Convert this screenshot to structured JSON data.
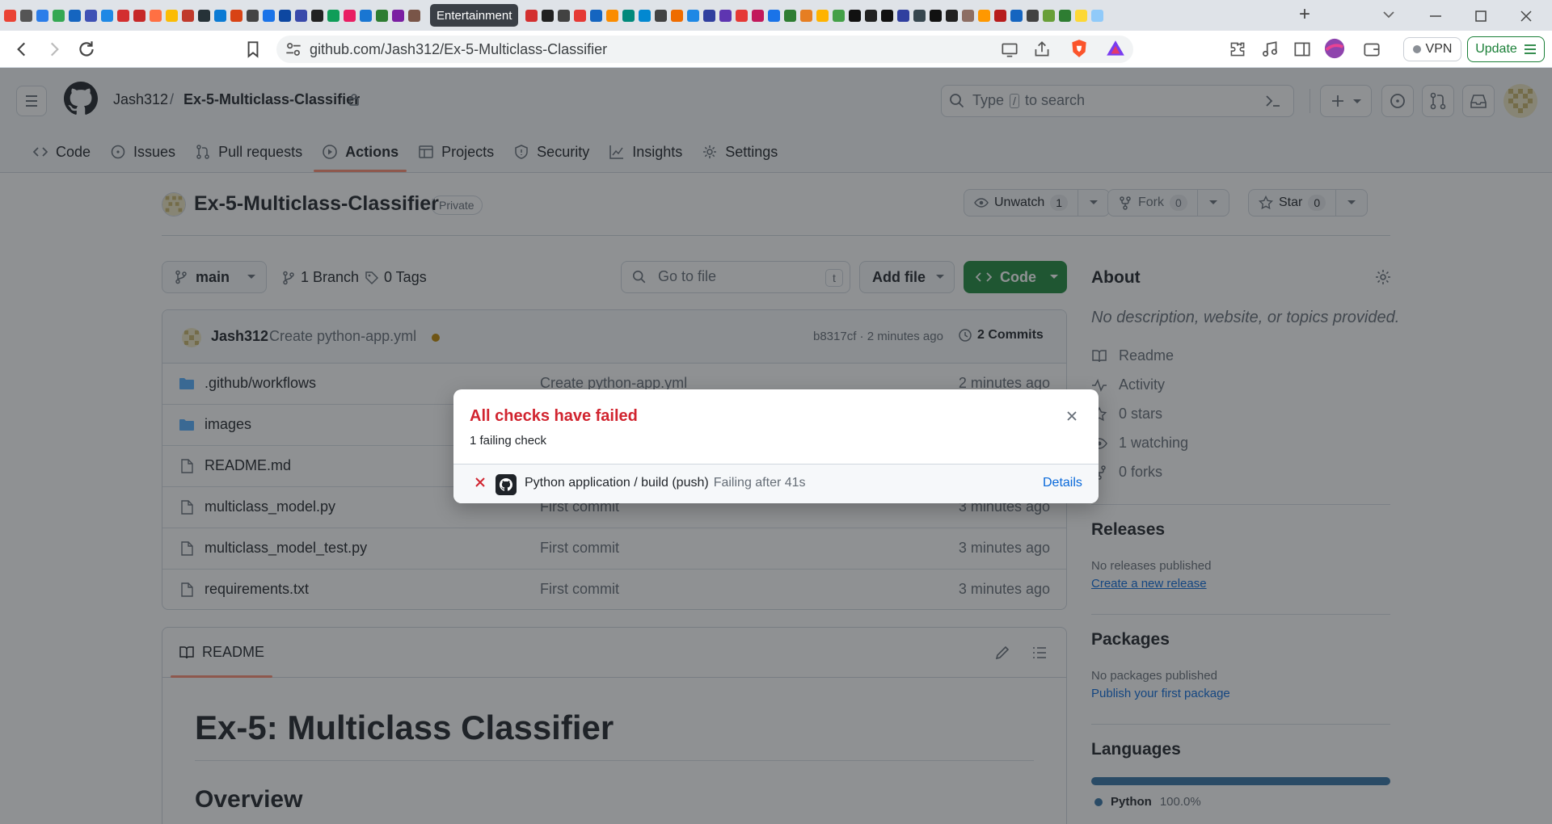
{
  "browser": {
    "active_tab_label": "Entertainment",
    "url": "github.com/Jash312/Ex-5-Multiclass-Classifier",
    "vpn_label": "VPN",
    "update_label": "Update",
    "favicon_colors": [
      "#ea4335",
      "#555",
      "#2b7de9",
      "#34a853",
      "#1565c0",
      "#3f51b5",
      "#1e88e5",
      "#d32f2f",
      "#c62828",
      "#ff7043",
      "#fbbc05",
      "#c0392b",
      "#263238",
      "#0b7bd4",
      "#d84315",
      "#444",
      "#1a73e8",
      "#0d47a1",
      "#3949ab",
      "#222",
      "#0f9d58",
      "#e91e63",
      "#1976d2",
      "#2e7d32",
      "#7b1fa2",
      "#795548"
    ],
    "favicon_colors_right": [
      "#d32f2f",
      "#212121",
      "#424242",
      "#e53935",
      "#1565c0",
      "#fb8c00",
      "#00897b",
      "#0288d1",
      "#424242",
      "#ef6c00",
      "#1e88e5",
      "#303f9f",
      "#5e35b1",
      "#e53935",
      "#c2185b",
      "#1a73e8",
      "#2e7d32",
      "#e67e22",
      "#ffb300",
      "#43a047",
      "#111",
      "#212121",
      "#111",
      "#303f9f",
      "#37474f",
      "#111",
      "#212121",
      "#8d6e63",
      "#ff9800",
      "#b71c1c",
      "#1565c0",
      "#424242",
      "#689f38",
      "#2e7d32",
      "#fdd835",
      "#90caf9"
    ]
  },
  "header": {
    "owner": "Jash312",
    "separator": "/",
    "repo": "Ex-5-Multiclass-Classifier",
    "search_prefix": "Type",
    "search_key": "/",
    "search_suffix": "to search"
  },
  "nav": [
    {
      "label": "Code",
      "icon": "code-icon"
    },
    {
      "label": "Issues",
      "icon": "issue-icon"
    },
    {
      "label": "Pull requests",
      "icon": "pull-request-icon"
    },
    {
      "label": "Actions",
      "icon": "play-icon",
      "active": true
    },
    {
      "label": "Projects",
      "icon": "table-icon"
    },
    {
      "label": "Security",
      "icon": "shield-icon"
    },
    {
      "label": "Insights",
      "icon": "graph-icon"
    },
    {
      "label": "Settings",
      "icon": "gear-icon"
    }
  ],
  "repo": {
    "title": "Ex-5-Multiclass-Classifier",
    "visibility": "Private",
    "unwatch_label": "Unwatch",
    "watch_count": "1",
    "fork_label": "Fork",
    "fork_count": "0",
    "star_label": "Star",
    "star_count": "0"
  },
  "browser_bar": {
    "branch": "main",
    "branches": "1 Branch",
    "tags": "0 Tags",
    "goto_placeholder": "Go to file",
    "goto_key": "t",
    "add_file": "Add file",
    "code": "Code"
  },
  "last_commit": {
    "author": "Jash312",
    "message": "Create python-app.yml",
    "hash_time": "b8317cf · 2 minutes ago",
    "commits": "2 Commits"
  },
  "files": [
    {
      "name": ".github/workflows",
      "type": "folder",
      "message": "Create python-app.yml",
      "time": "2 minutes ago"
    },
    {
      "name": "images",
      "type": "folder",
      "message": "",
      "time": ""
    },
    {
      "name": "README.md",
      "type": "file",
      "message": "",
      "time": ""
    },
    {
      "name": "multiclass_model.py",
      "type": "file",
      "message": "First commit",
      "time": "3 minutes ago"
    },
    {
      "name": "multiclass_model_test.py",
      "type": "file",
      "message": "First commit",
      "time": "3 minutes ago"
    },
    {
      "name": "requirements.txt",
      "type": "file",
      "message": "First commit",
      "time": "3 minutes ago"
    }
  ],
  "readme": {
    "tab": "README",
    "h1": "Ex-5: Multiclass Classifier",
    "h2": "Overview"
  },
  "about": {
    "heading": "About",
    "description": "No description, website, or topics provided.",
    "links": [
      {
        "label": "Readme",
        "icon": "book-icon"
      },
      {
        "label": "Activity",
        "icon": "pulse-icon"
      },
      {
        "label": "0 stars",
        "icon": "star-icon"
      },
      {
        "label": "1 watching",
        "icon": "eye-icon"
      },
      {
        "label": "0 forks",
        "icon": "fork-icon"
      }
    ]
  },
  "releases": {
    "heading": "Releases",
    "none": "No releases published",
    "link": "Create a new release"
  },
  "packages": {
    "heading": "Packages",
    "none": "No packages published",
    "link": "Publish your first package"
  },
  "languages": {
    "heading": "Languages",
    "items": [
      {
        "name": "Python",
        "percent": "100.0%",
        "fraction": 1.0,
        "color": "#3572A5"
      }
    ]
  },
  "modal": {
    "title": "All checks have failed",
    "subtitle": "1 failing check",
    "check_name": "Python application / build (push)",
    "check_status": "Failing after 41s",
    "details": "Details"
  },
  "colors": {
    "accent_green": "#1f883d",
    "fail_red": "#d1242f",
    "link_blue": "#0969da",
    "tab_underline": "#fd8c73"
  }
}
